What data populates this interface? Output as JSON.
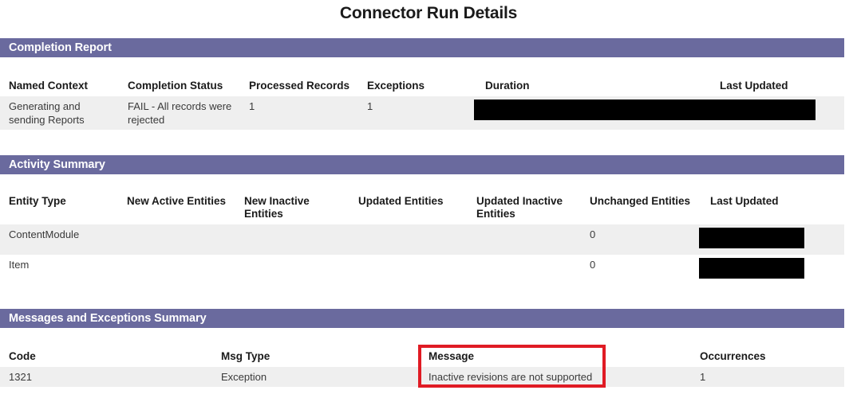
{
  "page": {
    "title": "Connector Run Details"
  },
  "sections": {
    "completion_report": {
      "heading": "Completion Report",
      "columns": [
        "Named Context",
        "Completion Status",
        "Processed Records",
        "Exceptions",
        "Duration",
        "Last Updated"
      ],
      "rows": [
        {
          "named_context": "Generating and sending Reports",
          "completion_status": "FAIL - All records were rejected",
          "processed_records": "1",
          "exceptions": "1",
          "duration": "",
          "last_updated": "",
          "redacted": true
        }
      ]
    },
    "activity_summary": {
      "heading": "Activity Summary",
      "columns": [
        "Entity Type",
        "New Active Entities",
        "New Inactive Entities",
        "Updated Entities",
        "Updated Inactive Entities",
        "Unchanged Entities",
        "Last Updated"
      ],
      "rows": [
        {
          "entity_type": "ContentModule",
          "new_active_entities": "",
          "new_inactive_entities": "",
          "updated_entities": "",
          "updated_inactive_entities": "",
          "unchanged_entities": "0",
          "last_updated": "",
          "redacted": true
        },
        {
          "entity_type": "Item",
          "new_active_entities": "",
          "new_inactive_entities": "",
          "updated_entities": "",
          "updated_inactive_entities": "",
          "unchanged_entities": "0",
          "last_updated": "",
          "redacted": true
        }
      ]
    },
    "messages_exceptions": {
      "heading": "Messages and Exceptions Summary",
      "columns": [
        "Code",
        "Msg Type",
        "Message",
        "Occurrences"
      ],
      "rows": [
        {
          "code": "1321",
          "msg_type": "Exception",
          "message": "Inactive revisions are not supported",
          "occurrences": "1"
        }
      ]
    }
  },
  "annotations": {
    "message_highlight": {
      "color": "#e01b24",
      "target": "Message"
    }
  },
  "colors": {
    "section_bar": "#6a6a9e",
    "zebra_row": "#efefef",
    "highlight": "#e01b24",
    "redaction": "#000000"
  }
}
